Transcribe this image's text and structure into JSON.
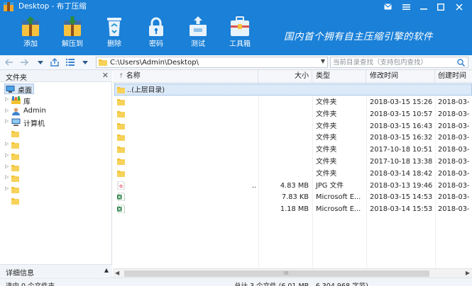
{
  "window": {
    "title": "Desktop - 布丁压缩",
    "buttons": [
      "mail-icon",
      "menu-icon",
      "minimize-icon",
      "maximize-icon",
      "close-icon"
    ]
  },
  "toolbar": {
    "items": [
      {
        "label": "添加",
        "icon": "add-archive-icon"
      },
      {
        "label": "解压到",
        "icon": "extract-icon"
      },
      {
        "label": "删除",
        "icon": "recycle-bin-icon"
      },
      {
        "label": "密码",
        "icon": "lock-icon"
      },
      {
        "label": "测试",
        "icon": "test-box-icon"
      },
      {
        "label": "工具箱",
        "icon": "toolbox-icon"
      }
    ],
    "slogan": "国内首个拥有自主压缩引擎的软件"
  },
  "nav": {
    "path": "C:\\Users\\Admin\\Desktop\\",
    "search_placeholder": "当前目录查找（支持包内查找）"
  },
  "left_pane": {
    "title": "文件夹",
    "tree": [
      {
        "label": "桌面",
        "icon": "desktop-icon",
        "arrow": ""
      },
      {
        "label": "库",
        "icon": "library-icon",
        "arrow": "▷"
      },
      {
        "label": "Admin",
        "icon": "user-icon",
        "arrow": "▷"
      },
      {
        "label": "计算机",
        "icon": "computer-icon",
        "arrow": "▷"
      },
      {
        "label": "",
        "icon": "folder-icon",
        "arrow": ""
      },
      {
        "label": "",
        "icon": "folder-icon",
        "arrow": "▷"
      },
      {
        "label": "",
        "icon": "folder-icon",
        "arrow": "▷"
      },
      {
        "label": "",
        "icon": "folder-icon",
        "arrow": "▷"
      },
      {
        "label": "",
        "icon": "folder-icon",
        "arrow": "▷"
      },
      {
        "label": "",
        "icon": "folder-icon",
        "arrow": "▷"
      },
      {
        "label": "",
        "icon": "folder-icon",
        "arrow": ""
      }
    ],
    "footer": "详细信息"
  },
  "file_list": {
    "columns": [
      "名称",
      "大小",
      "类型",
      "修改时间",
      "创建时间"
    ],
    "parent_row": "..(上层目录)",
    "rows": [
      {
        "name": "",
        "size": "",
        "type": "文件夹",
        "modified": "2018-03-15 15:26",
        "created": "2018-03-",
        "icon": "folder-icon"
      },
      {
        "name": "",
        "size": "",
        "type": "文件夹",
        "modified": "2018-03-15 10:57",
        "created": "2018-03-",
        "icon": "folder-icon"
      },
      {
        "name": "",
        "size": "",
        "type": "文件夹",
        "modified": "2018-03-15 16:43",
        "created": "2018-03-",
        "icon": "folder-icon"
      },
      {
        "name": "",
        "size": "",
        "type": "文件夹",
        "modified": "2018-03-15 16:32",
        "created": "2018-03-",
        "icon": "folder-icon"
      },
      {
        "name": "",
        "size": "",
        "type": "文件夹",
        "modified": "2017-10-18 10:51",
        "created": "2018-03-",
        "icon": "folder-icon"
      },
      {
        "name": "",
        "size": "",
        "type": "文件夹",
        "modified": "2017-10-18 13:38",
        "created": "2018-03-",
        "icon": "folder-icon"
      },
      {
        "name": "",
        "size": "",
        "type": "文件夹",
        "modified": "2018-03-14 18:42",
        "created": "2018-03-",
        "icon": "folder-icon"
      },
      {
        "name": "..",
        "size": "4.83 MB",
        "type": "JPG 文件",
        "modified": "2018-03-13 19:46",
        "created": "2018-03-",
        "icon": "image-file-icon"
      },
      {
        "name": "",
        "size": "7.83 KB",
        "type": "Microsoft E...",
        "modified": "2018-03-15 14:53",
        "created": "2018-03-",
        "icon": "excel-file-icon"
      },
      {
        "name": "",
        "size": "1.18 MB",
        "type": "Microsoft E...",
        "modified": "2018-03-14 15:53",
        "created": "2018-03-",
        "icon": "excel-file-icon"
      }
    ]
  },
  "scrollbar": {
    "grip": "III"
  },
  "status": {
    "left": "选中 0 个文件夹",
    "center": "总计 3 个文件 (6.01 MB，6,304,968 字节)"
  },
  "colors": {
    "header_blue": "#1a80d8",
    "selection": "#dbe9f8",
    "folder": "#f2c230"
  }
}
